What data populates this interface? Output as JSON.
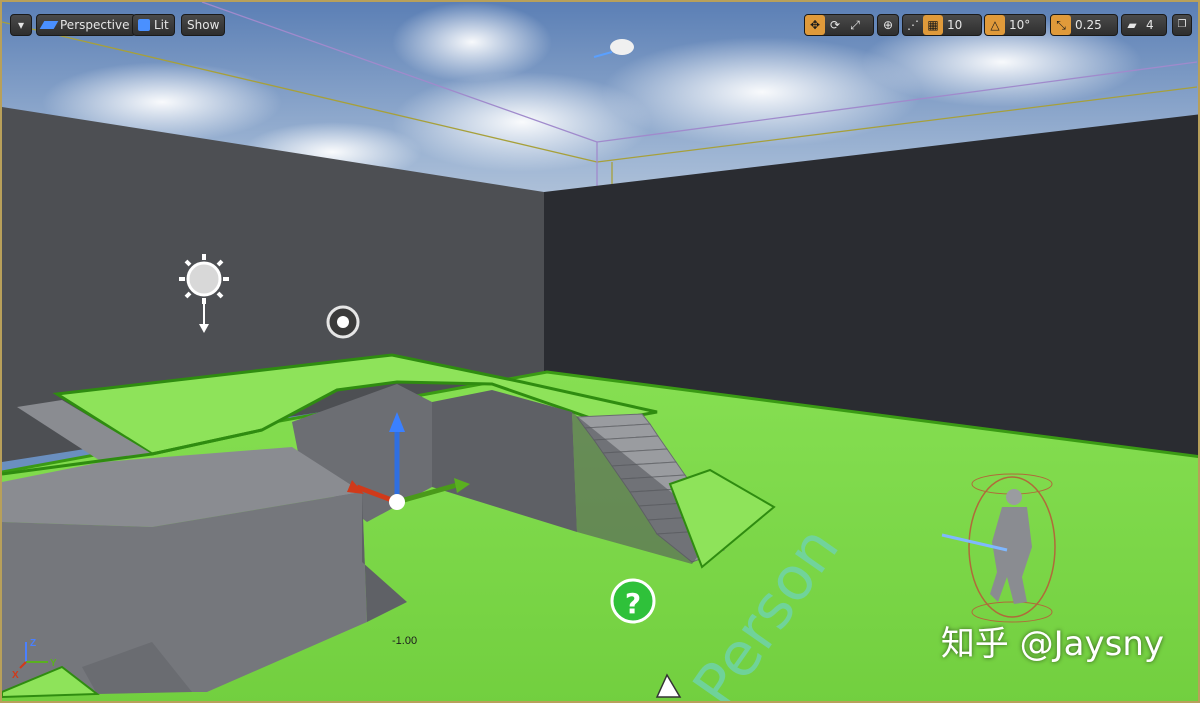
{
  "toolbar": {
    "view_mode": "Perspective",
    "lit_mode": "Lit",
    "show_label": "Show",
    "grid_snap": "10",
    "rotation_snap": "10°",
    "scale_snap": "0.25",
    "camera_speed": "4"
  },
  "viewport": {
    "coordinate_readout": "-1.00",
    "floor_text": "Person",
    "axis_x": "X",
    "axis_y": "Y",
    "axis_z": "Z"
  },
  "watermark": "知乎 @Jaysny",
  "colors": {
    "grass": "#7fd94a",
    "grass_edge": "#3a9a14",
    "wall_left": "#4d4f53",
    "wall_right": "#2a2c31",
    "block": "#7c7e83",
    "accent_orange": "#e09a3a",
    "frame": "#b8a05a"
  }
}
